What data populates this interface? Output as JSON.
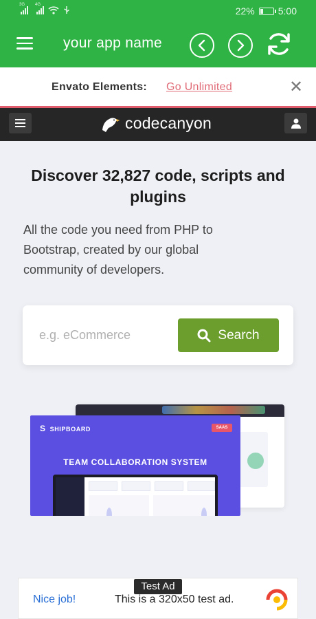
{
  "status_bar": {
    "net_left": "3G",
    "net_right": "4G",
    "battery": "22%",
    "battery_level": 0.22,
    "time": "5:00"
  },
  "toolbar": {
    "title": "your app name",
    "back_icon": "chevron-left-icon",
    "forward_icon": "chevron-right-icon",
    "refresh_icon": "refresh-icon"
  },
  "banner": {
    "label": "Envato Elements:",
    "link": "Go Unlimited",
    "close": "✕"
  },
  "site_header": {
    "logo_text": "codecanyon",
    "menu_icon": "menu-icon",
    "user_icon": "user-icon"
  },
  "hero": {
    "title": "Discover 32,827 code, scripts and plugins",
    "subtitle": "All the code you need from PHP to Bootstrap, created by our global community of developers."
  },
  "search": {
    "placeholder": "e.g. eCommerce",
    "button_label": "Search"
  },
  "preview": {
    "brand": "SHIPBOARD",
    "badge": "SAAS",
    "heading": "TEAM COLLABORATION SYSTEM"
  },
  "ad": {
    "label": "Test Ad",
    "cta": "Nice job!",
    "text": "This is a 320x50 test ad."
  },
  "colors": {
    "app_bar": "#2fb345",
    "banner_link": "#e06a76",
    "search_button": "#6b9e2c",
    "preview_card": "#5a4fe0"
  }
}
